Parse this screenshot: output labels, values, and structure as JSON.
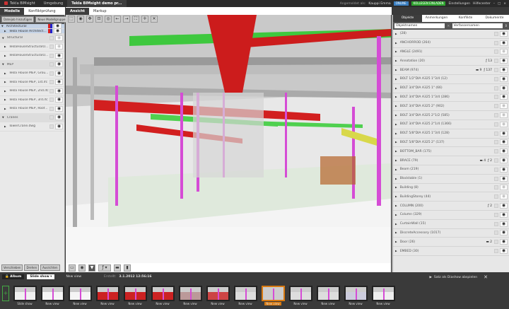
{
  "topbar": {
    "app_tabs": [
      "Tekla BIMsight",
      "Umgebung",
      "Tekla BIMsight demo pr..."
    ],
    "logged_in": "Angemeldet als:",
    "user": "Kauppi Emma",
    "online": "ONLINE",
    "invite": "KOLLEGEN EINLADEN",
    "settings": "Einstellungen",
    "help": "Hilfecenter",
    "colors": {
      "online": "#3a7fc1",
      "invite": "#2fa52f"
    }
  },
  "left": {
    "tabs": [
      "Modelle",
      "Konfliktprüfung"
    ],
    "buttons": [
      "Dateijob hinzufügen",
      "Neue Modellgruppe"
    ],
    "rows": [
      {
        "label": "Architectural",
        "type": "group",
        "sel": true,
        "eye": true,
        "cube": true
      },
      {
        "label": "Tekla House Architectu...",
        "type": "item",
        "sel": true,
        "eye": true,
        "cube": true
      },
      {
        "label": "Structural",
        "type": "group",
        "eye": false
      },
      {
        "label": "TeklaHouseStructuralO...",
        "type": "item",
        "eye": false
      },
      {
        "label": "TeklaHouseStructuralO...",
        "type": "item",
        "eye": true
      },
      {
        "label": "MEP",
        "type": "group",
        "eye": true
      },
      {
        "label": "Tekla House MEP, Grou...",
        "type": "item",
        "eye": true
      },
      {
        "label": "Tekla House MEP, 1st.ifc",
        "type": "item",
        "eye": true
      },
      {
        "label": "Tekla House MEP, 2nd.ifc",
        "type": "item",
        "eye": true
      },
      {
        "label": "Tekla House MEP, 3rd.ifc",
        "type": "item",
        "eye": true
      },
      {
        "label": "Tekla House MEP, Roof...",
        "type": "item",
        "eye": true
      },
      {
        "label": "Cranes",
        "type": "group",
        "eye": true
      },
      {
        "label": "TowerCrane.dwg",
        "type": "item",
        "eye": true
      }
    ],
    "bottom_buttons": [
      "Verschieben",
      "Drehen",
      "Ausrichten"
    ]
  },
  "viewer": {
    "tabs": [
      "Ansicht",
      "Markup"
    ]
  },
  "right": {
    "tabs": [
      "Objekte",
      "Anmerkungen",
      "Konflikte",
      "Dokumente"
    ],
    "filter1": "Objektnamen",
    "filter2": "Verfassernamen",
    "rows": [
      {
        "label": "(28)",
        "eye": true
      },
      {
        "label": "ANCHORROD (264)",
        "eye": true
      },
      {
        "label": "ANGLE (2491)",
        "eye": false
      },
      {
        "label": "Annotation (20)",
        "eye": true,
        "flags": "13"
      },
      {
        "label": "BEAM (974)",
        "eye": true,
        "comments": "9",
        "flags": "137"
      },
      {
        "label": "BOLT 1/2\"DIA A325 1\"3/4 (12)",
        "eye": true
      },
      {
        "label": "BOLT 3/4\"DIA A325 1\" (66)",
        "eye": true
      },
      {
        "label": "BOLT 3/4\"DIA A325 1\"3/4 (286)",
        "eye": true
      },
      {
        "label": "BOLT 3/4\"DIA A325 2\" (902)",
        "eye": false
      },
      {
        "label": "BOLT 3/4\"DIA A325 2\"1/2 (585)",
        "eye": false
      },
      {
        "label": "BOLT 3/4\"DIA A325 2\"1/4 (1366)",
        "eye": false
      },
      {
        "label": "BOLT 5/8\"DIA A325 1\"3/4 (128)",
        "eye": true
      },
      {
        "label": "BOLT 5/8\"DIA A325 2\" (137)",
        "eye": true
      },
      {
        "label": "BOTTOM_BAR (175)",
        "eye": true
      },
      {
        "label": "BRACE (79)",
        "eye": true,
        "comments": "4",
        "flags": "2"
      },
      {
        "label": "Beam (219)",
        "eye": true
      },
      {
        "label": "Blocktable (1)",
        "eye": true
      },
      {
        "label": "Building (8)",
        "eye": false
      },
      {
        "label": "BuildingStorey (44)",
        "eye": false
      },
      {
        "label": "COLUMN (200)",
        "eye": true,
        "flags": "2"
      },
      {
        "label": "Column (329)",
        "eye": true
      },
      {
        "label": "CurtainWall (15)",
        "eye": true
      },
      {
        "label": "DiscreteAccessory (1017)",
        "eye": true
      },
      {
        "label": "Door (26)",
        "eye": true,
        "comments": "2"
      },
      {
        "label": "EMBED (30)",
        "eye": true
      }
    ]
  },
  "album": {
    "album_label": "Album",
    "slideshow": "Slide show",
    "current_view": "New view",
    "created_label": "Erstellt:",
    "created": "3.1.2012 12:56:16",
    "save_slideshow": "Satz als Diashow abspielen",
    "thumbs": [
      "Slide show",
      "New view",
      "New view",
      "New view",
      "New view",
      "New view",
      "New view",
      "New view",
      "New view",
      "New view",
      "New view",
      "New view",
      "New view",
      "New view"
    ],
    "active_index": 9
  }
}
